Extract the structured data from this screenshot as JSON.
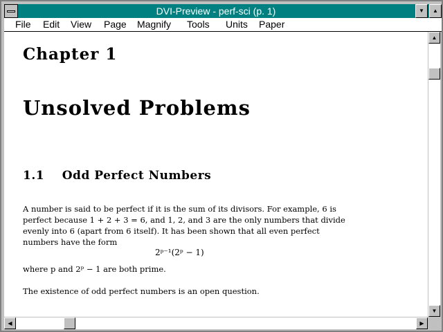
{
  "window": {
    "title": "DVI-Preview - perf-sci (p. 1)",
    "title_bar_color": "#008080"
  },
  "menu": [
    {
      "label": "File"
    },
    {
      "label": "Edit"
    },
    {
      "label": "View"
    },
    {
      "label": "Page"
    },
    {
      "label": "Magnify"
    },
    {
      "label": "Tools"
    },
    {
      "label": "Units"
    },
    {
      "label": "Paper"
    }
  ],
  "document": {
    "chapter": "Chapter 1",
    "title": "Unsolved Problems",
    "section": "1.1    Odd Perfect Numbers",
    "paragraph1_lines": [
      "A number is said to be perfect if it is the sum of its divisors.  For example, 6 is",
      "perfect because 1 + 2 + 3 = 6, and 1, 2, and 3 are the only numbers that divide",
      "evenly into 6 (apart from 6 itself).  It has been shown that all even perfect",
      "numbers have the form"
    ],
    "equation": "2ᵖ⁻¹(2ᵖ − 1)",
    "after_equation": "where p and 2ᵖ − 1 are both prime.",
    "paragraph2": "The existence of odd perfect numbers is an open question."
  },
  "icons": {
    "system_menu": "system-menu-icon",
    "minimize": "minimize-icon",
    "maximize": "maximize-icon",
    "scroll_up": "scroll-up-arrow-icon",
    "scroll_down": "scroll-down-arrow-icon",
    "scroll_left": "scroll-left-arrow-icon",
    "scroll_right": "scroll-right-arrow-icon"
  }
}
